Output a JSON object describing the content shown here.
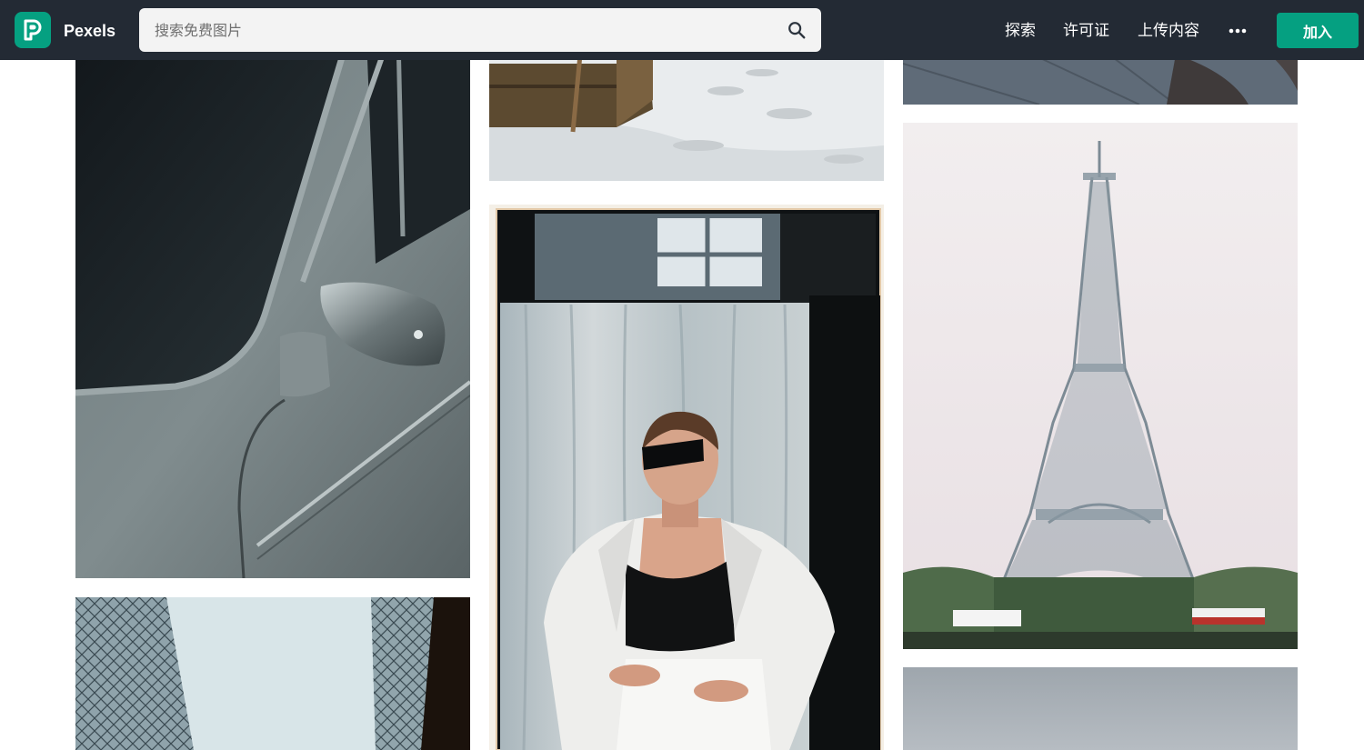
{
  "header": {
    "brand": "Pexels",
    "search": {
      "placeholder": "搜索免费图片",
      "value": ""
    },
    "nav": {
      "explore": "探索",
      "license": "许可证",
      "upload": "上传内容",
      "more_icon": "more-dots-icon",
      "join": "加入"
    }
  },
  "photos": [
    {
      "id": "photo-car-mirror",
      "subject": "vintage car side mirror"
    },
    {
      "id": "photo-buildings-sky",
      "subject": "glass buildings against sky"
    },
    {
      "id": "photo-snow-garden",
      "subject": "snow with wooden planter"
    },
    {
      "id": "photo-woman-sunglasses",
      "subject": "woman in white suit with sunglasses"
    },
    {
      "id": "photo-street-top",
      "subject": "pavement"
    },
    {
      "id": "photo-eiffel-tower",
      "subject": "Eiffel Tower"
    },
    {
      "id": "photo-sky-bottom",
      "subject": "grey sky"
    }
  ],
  "colors": {
    "header_bg": "#232a34",
    "brand_green": "#05a081",
    "search_bg": "#f3f3f3"
  }
}
